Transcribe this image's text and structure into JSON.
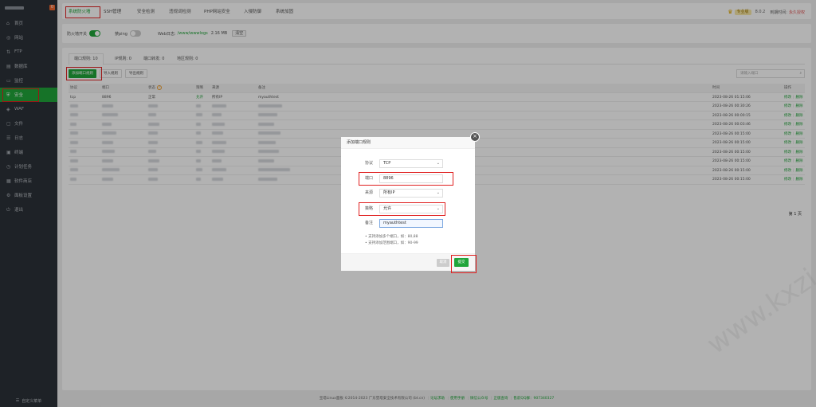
{
  "sidebar": {
    "badge": "0",
    "items": [
      {
        "label": "首页",
        "icon": "home-icon"
      },
      {
        "label": "网站",
        "icon": "globe-icon"
      },
      {
        "label": "FTP",
        "icon": "ftp-icon"
      },
      {
        "label": "数据库",
        "icon": "database-icon"
      },
      {
        "label": "监控",
        "icon": "monitor-icon"
      },
      {
        "label": "安全",
        "icon": "shield-icon",
        "active": true
      },
      {
        "label": "WAF",
        "icon": "waf-icon"
      },
      {
        "label": "文件",
        "icon": "folder-icon"
      },
      {
        "label": "日志",
        "icon": "log-icon"
      },
      {
        "label": "终端",
        "icon": "terminal-icon"
      },
      {
        "label": "计划任务",
        "icon": "clock-icon"
      },
      {
        "label": "软件商店",
        "icon": "store-icon"
      },
      {
        "label": "面板设置",
        "icon": "settings-icon"
      },
      {
        "label": "退出",
        "icon": "logout-icon"
      }
    ],
    "footer": "自定义菜单"
  },
  "topbar": {
    "tabs": [
      "系统防火墙",
      "SSH管理",
      "安全检测",
      "违规词检测",
      "PHP网站安全",
      "入侵防御",
      "系统加固"
    ],
    "pro_badge": "专业版",
    "version": "8.0.2",
    "expire_label": "到期时间:",
    "expire_value": "永久授权"
  },
  "switches": {
    "firewall_label": "防火墙开关",
    "ping_label": "禁ping",
    "weblog_label": "Web日志:",
    "weblog_path": "/www/wwwlogs",
    "weblog_size": "2.16 MB",
    "clear_btn": "清空"
  },
  "tabs": [
    {
      "label": "端口规则: 10",
      "active": true
    },
    {
      "label": "IP规则: 0"
    },
    {
      "label": "端口转发: 0"
    },
    {
      "label": "地区规则: 0"
    }
  ],
  "actions": {
    "add": "添加端口规则",
    "import": "导入规则",
    "export": "导出规则",
    "search_placeholder": "请输入端口"
  },
  "table": {
    "headers": {
      "proto": "协议",
      "port": "端口",
      "status": "状态",
      "policy": "策略",
      "source": "来源",
      "remark": "备注",
      "time": "时间",
      "op": "操作"
    },
    "first_row": {
      "proto": "tcp",
      "port": "8896",
      "status": "正常",
      "policy": "允许",
      "source": "所有IP",
      "remark": "myauthtest",
      "time": "2023-08-26 01:15:06"
    },
    "times": [
      "2023-08-26 00:30:26",
      "2023-08-26 00:00:15",
      "2023-08-26 00:03:46",
      "2023-08-26 00:15:00",
      "2023-08-26 00:15:00",
      "2023-08-26 00:15:00",
      "2023-08-26 00:15:00",
      "2023-08-26 00:15:00",
      "2023-08-26 00:15:00"
    ],
    "edit": "修改",
    "delete": "删除",
    "pager": "第 1 页"
  },
  "modal": {
    "title": "添加端口规则",
    "protocol_label": "协议",
    "protocol_value": "TCP",
    "port_label": "端口",
    "port_value": "8896",
    "source_label": "来源",
    "source_value": "所有IP",
    "policy_label": "策略",
    "policy_value": "允许",
    "remark_label": "备注",
    "remark_value": "myauthtest",
    "tip1": "支持添加多个端口，如：80,88",
    "tip2": "支持添加范围端口，如：90-99",
    "cancel": "取消",
    "submit": "提交"
  },
  "footer": {
    "copyright": "宝塔Linux面板 ©2014-2023 广东堡塔安全技术有限公司 (bt.cn)",
    "links": [
      "论坛求助",
      "使用手册",
      "微信公众号",
      "正版查询",
      "售前QQ群：907340327"
    ]
  },
  "watermark": "www.kxzi.cn",
  "colors": {
    "accent": "#20a53a",
    "highlight": "#e02020",
    "sidebar": "#2c3138"
  }
}
